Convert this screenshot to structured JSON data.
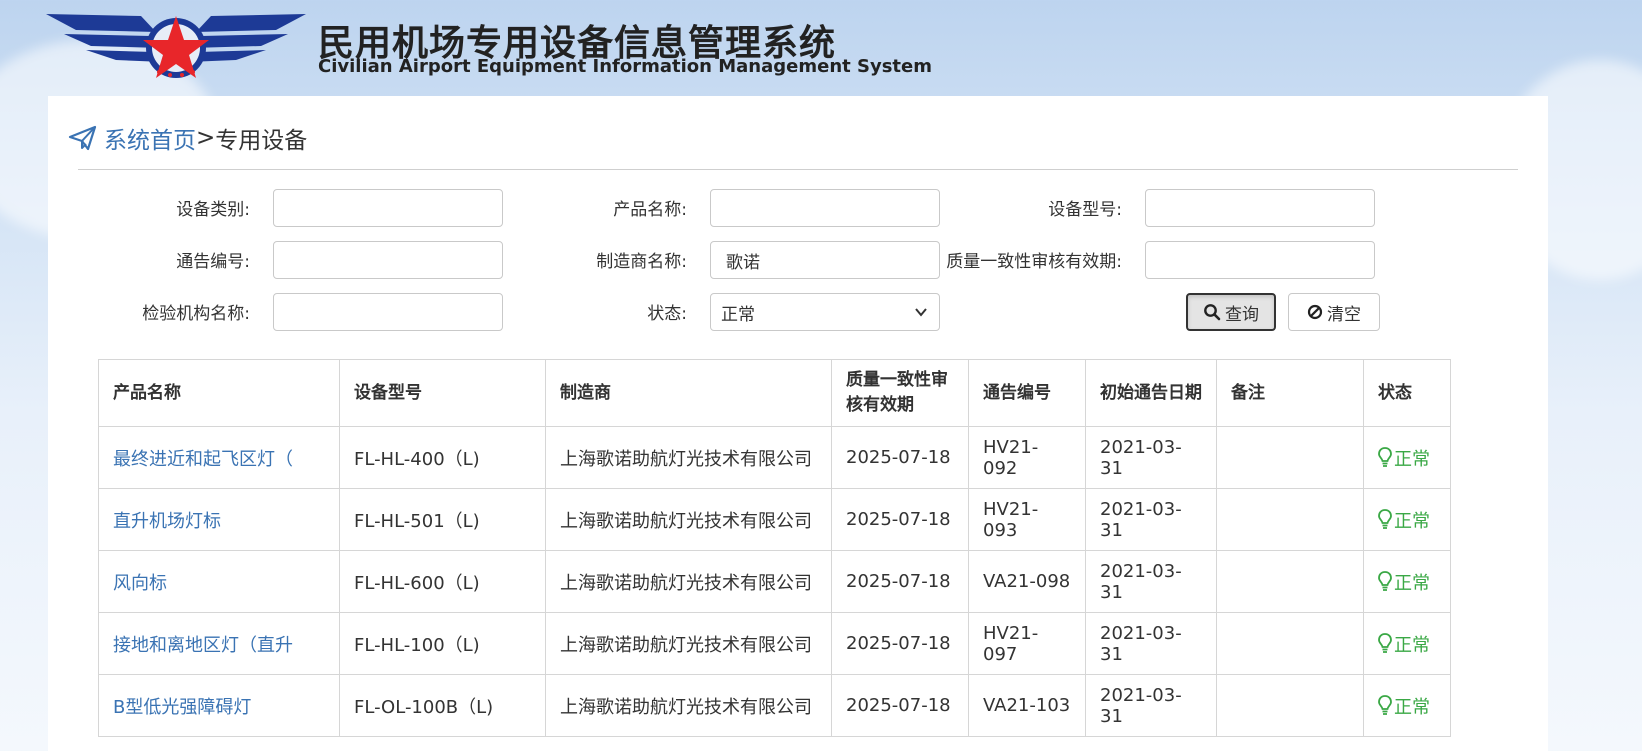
{
  "header": {
    "title_cn": "民用机场专用设备信息管理系统",
    "title_en": "Civilian Airport Equipment Information Management System"
  },
  "breadcrumb": {
    "home": "系统首页",
    "separator": ">",
    "current": "专用设备"
  },
  "filters": {
    "category_label": "设备类别:",
    "category_value": "",
    "product_label": "产品名称:",
    "product_value": "",
    "model_label": "设备型号:",
    "model_value": "",
    "notice_label": "通告编号:",
    "notice_value": "",
    "manufacturer_label": "制造商名称:",
    "manufacturer_value": "歌诺",
    "validity_label": "质量一致性审核有效期:",
    "validity_value": "",
    "inspector_label": "检验机构名称:",
    "inspector_value": "",
    "status_label": "状态:",
    "status_value": "正常",
    "search_label": "查询",
    "clear_label": "清空"
  },
  "table": {
    "headers": [
      "产品名称",
      "设备型号",
      "制造商",
      "质量一致性审核有效期",
      "通告编号",
      "初始通告日期",
      "备注",
      "状态"
    ],
    "rows": [
      {
        "name": "最终进近和起飞区灯（",
        "model": "FL-HL-400（L)",
        "maker": "上海歌诺助航灯光技术有限公司",
        "valid": "2025-07-18",
        "notice": "HV21-092",
        "date": "2021-03-31",
        "note": "",
        "status": "正常"
      },
      {
        "name": "直升机场灯标",
        "model": "FL-HL-501（L)",
        "maker": "上海歌诺助航灯光技术有限公司",
        "valid": "2025-07-18",
        "notice": "HV21-093",
        "date": "2021-03-31",
        "note": "",
        "status": "正常"
      },
      {
        "name": "风向标",
        "model": "FL-HL-600（L)",
        "maker": "上海歌诺助航灯光技术有限公司",
        "valid": "2025-07-18",
        "notice": "VA21-098",
        "date": "2021-03-31",
        "note": "",
        "status": "正常"
      },
      {
        "name": "接地和离地区灯（直升",
        "model": "FL-HL-100（L)",
        "maker": "上海歌诺助航灯光技术有限公司",
        "valid": "2025-07-18",
        "notice": "HV21-097",
        "date": "2021-03-31",
        "note": "",
        "status": "正常"
      },
      {
        "name": "B型低光强障碍灯",
        "model": "FL-OL-100B（L)",
        "maker": "上海歌诺助航灯光技术有限公司",
        "valid": "2025-07-18",
        "notice": "VA21-103",
        "date": "2021-03-31",
        "note": "",
        "status": "正常"
      }
    ]
  },
  "colors": {
    "link": "#3a73b3",
    "status_ok": "#3aa845",
    "logo_blue": "#1d3a96",
    "logo_red": "#e8262a"
  },
  "icons": {
    "breadcrumb": "paper-plane-icon",
    "search": "search-icon",
    "clear": "ban-icon",
    "status": "lightbulb-icon",
    "select": "chevron-down-icon"
  }
}
